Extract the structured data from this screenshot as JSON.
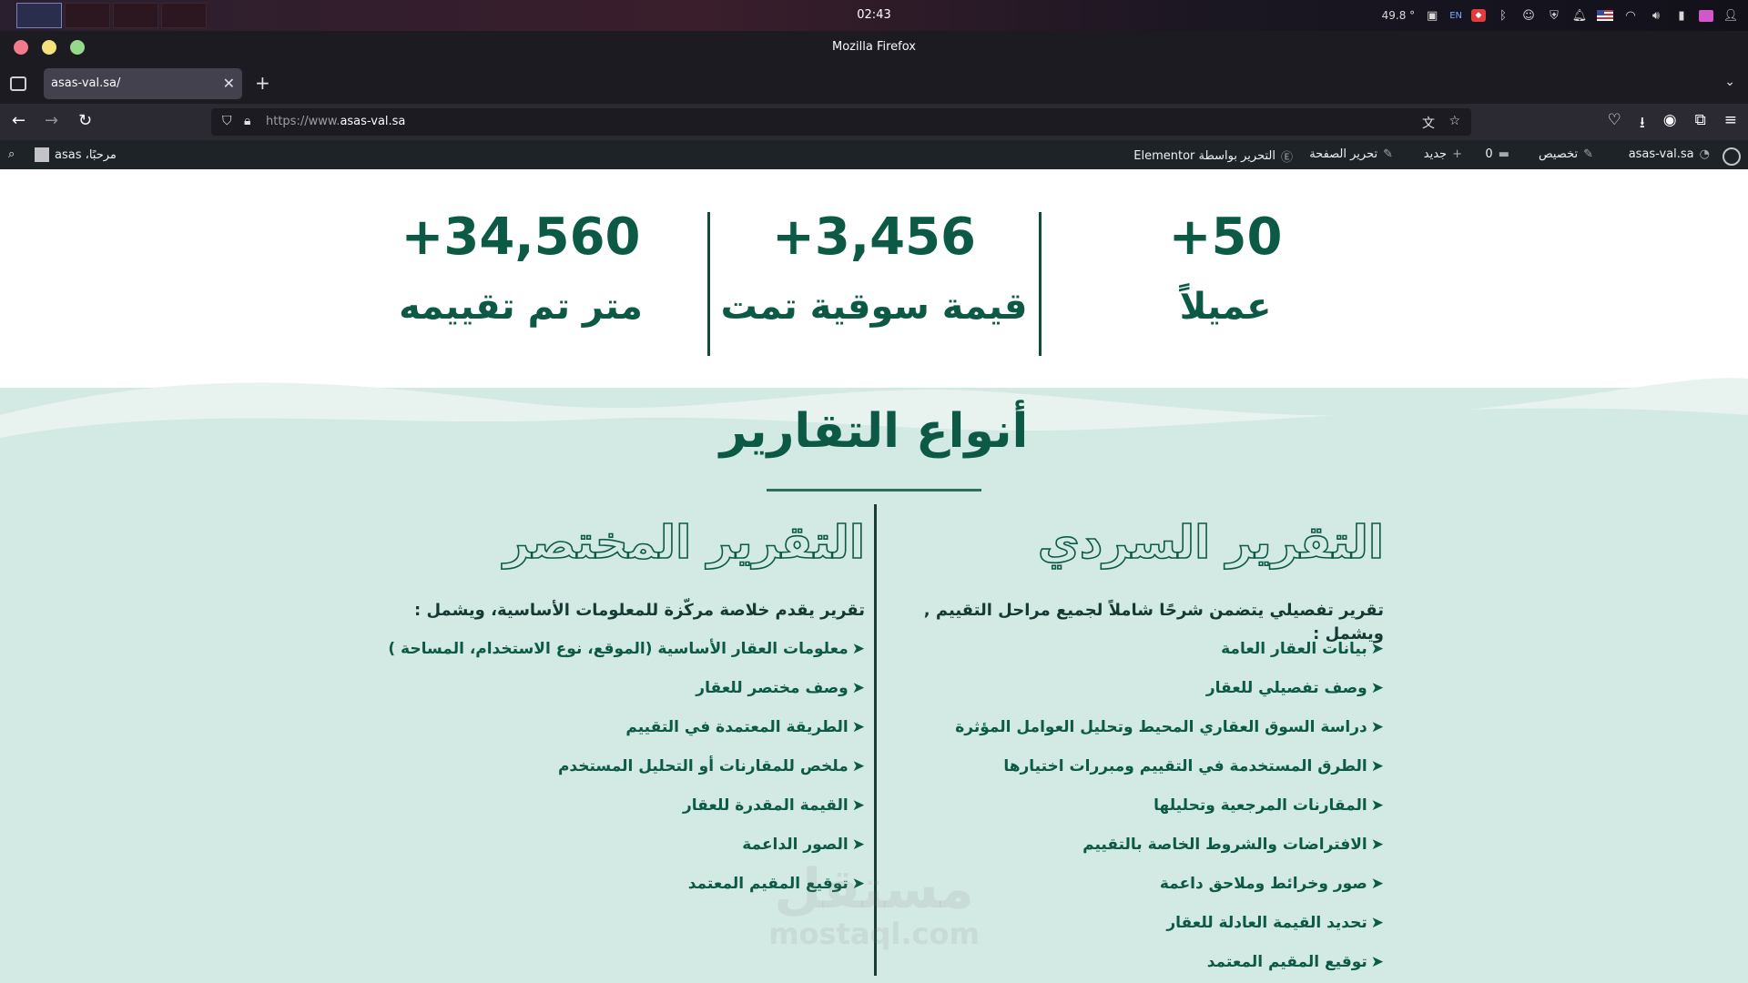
{
  "system": {
    "clock": "02:43",
    "temperature": "49.8 °",
    "keyboard_layout": "EN"
  },
  "window": {
    "title": "Mozilla Firefox"
  },
  "browser": {
    "tab_title": "asas-val.sa/",
    "url_protocol": "https://www.",
    "url_domain": "asas-val.sa"
  },
  "wp_admin_bar": {
    "site_name": "asas-val.sa",
    "customize": "تخصيص",
    "comments_count": "0",
    "new": "جديد",
    "edit_page": "تحرير الصفحة",
    "edit_elementor": "التحرير بواسطة Elementor",
    "greeting": "مرحبًا، asas"
  },
  "stats": [
    {
      "number": "+50",
      "label": "عميلاً"
    },
    {
      "number": "+3,456",
      "label": "قيمة سوقية تمت"
    },
    {
      "number": "+34,560",
      "label": "متر تم تقييمه"
    }
  ],
  "reports": {
    "title": "أنواع التقارير",
    "narrative": {
      "heading": "التقرير السردي",
      "intro": "تقرير تفصيلي يتضمن شرحًا شاملاً لجميع مراحل التقييم , ويشمل :",
      "items": [
        "بيانات العقار العامة",
        "وصف تفصيلي للعقار",
        "دراسة السوق العقاري المحيط وتحليل العوامل المؤثرة",
        "الطرق المستخدمة في التقييم ومبررات اختيارها",
        "المقارنات المرجعية وتحليلها",
        "الافتراضات والشروط الخاصة بالتقييم",
        "صور وخرائط وملاحق داعمة",
        "تحديد القيمة العادلة للعقار",
        "توقيع المقيم المعتمد"
      ]
    },
    "summary": {
      "heading": "التقرير المختصر",
      "intro": "تقرير يقدم خلاصة مركّزة للمعلومات الأساسية، ويشمل :",
      "items": [
        "معلومات العقار الأساسية (الموقع، نوع الاستخدام، المساحة )",
        "وصف مختصر للعقار",
        "الطريقة المعتمدة في التقييم",
        "ملخص للمقارنات أو التحليل المستخدم",
        "القيمة المقدرة للعقار",
        "الصور الداعمة",
        "توقيع المقيم المعتمد"
      ]
    }
  },
  "watermark": {
    "arabic": "مستقل",
    "latin": "mostaql.com"
  },
  "colors": {
    "brand_green": "#0c5a46",
    "mint_background": "#d3e9e3"
  }
}
